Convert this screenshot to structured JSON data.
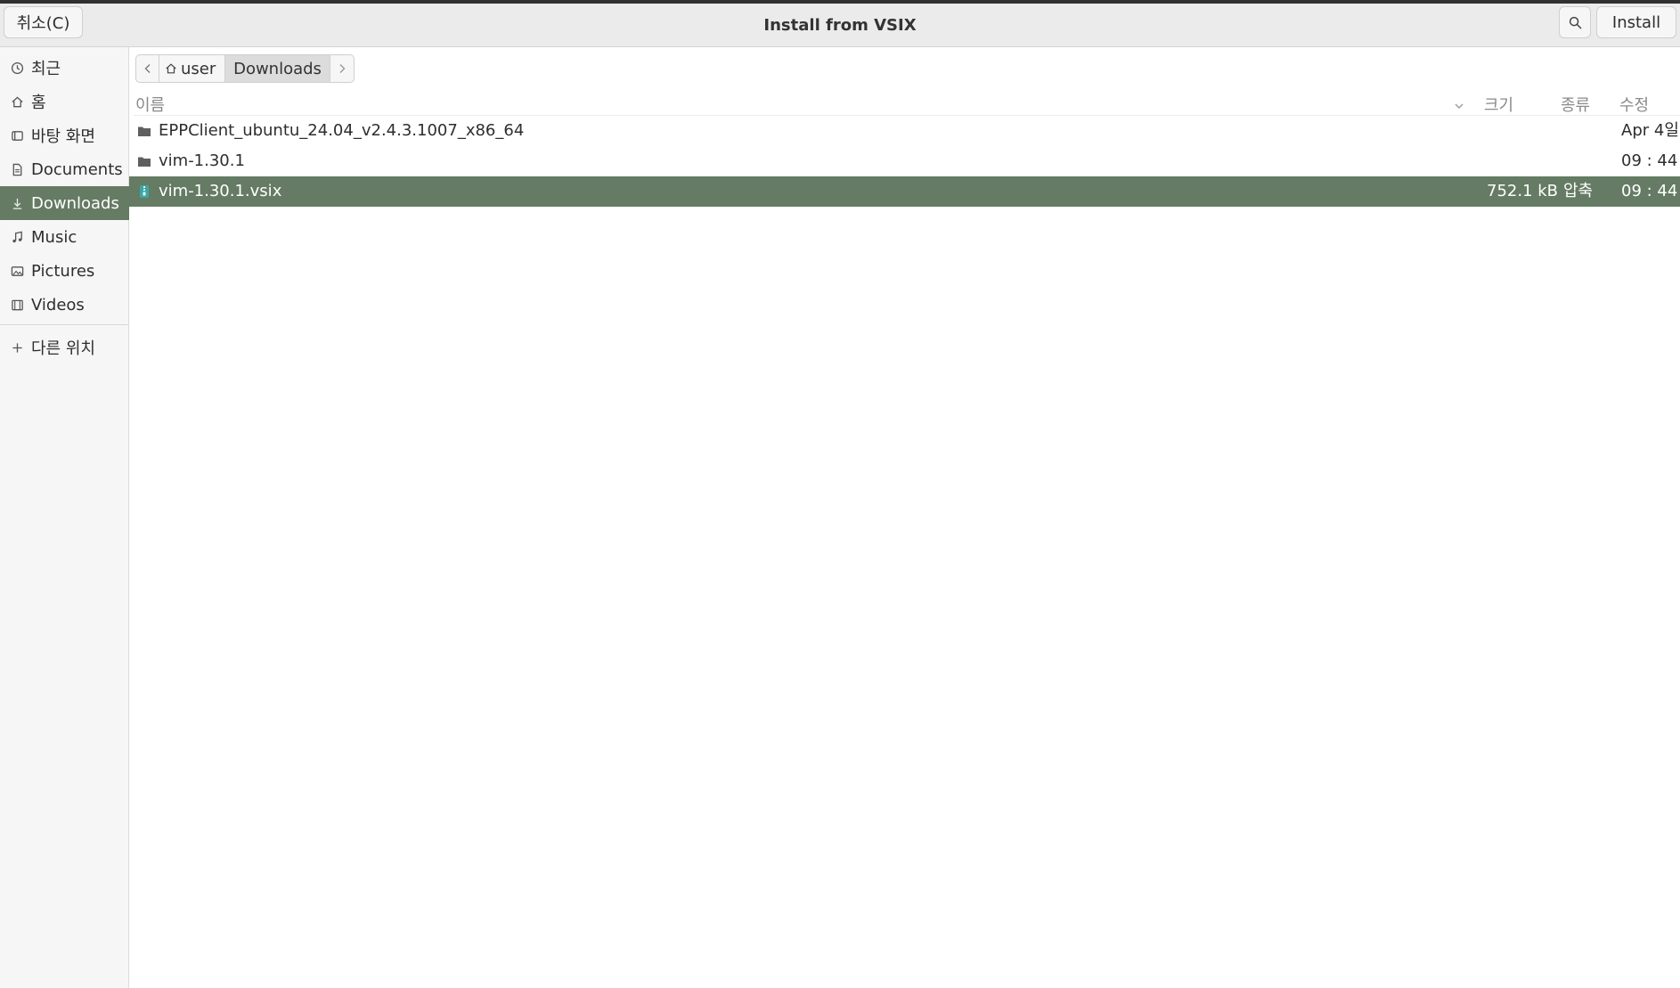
{
  "window": {
    "title": "Install from VSIX",
    "cancel_label": "취소(C)",
    "install_label": "Install",
    "search_icon": "search-icon"
  },
  "sidebar": {
    "items": [
      {
        "label": "최근",
        "icon": "clock-icon",
        "active": false
      },
      {
        "label": "홈",
        "icon": "home-icon",
        "active": false
      },
      {
        "label": "바탕 화면",
        "icon": "desktop-icon",
        "active": false
      },
      {
        "label": "Documents",
        "icon": "document-icon",
        "active": false
      },
      {
        "label": "Downloads",
        "icon": "download-icon",
        "active": true
      },
      {
        "label": "Music",
        "icon": "music-icon",
        "active": false
      },
      {
        "label": "Pictures",
        "icon": "picture-icon",
        "active": false
      },
      {
        "label": "Videos",
        "icon": "video-icon",
        "active": false
      }
    ],
    "other_locations": {
      "label": "다른 위치",
      "icon": "plus-icon"
    }
  },
  "pathbar": {
    "segments": [
      {
        "label": "user",
        "icon": "home-icon"
      },
      {
        "label": "Downloads",
        "current": true
      }
    ]
  },
  "file_list": {
    "columns": {
      "name": "이름",
      "size": "크기",
      "type": "종류",
      "modified": "수정"
    },
    "rows": [
      {
        "name": "EPPClient_ubuntu_24.04_v2.4.3.1007_x86_64",
        "icon": "folder-icon",
        "size": "",
        "type": "",
        "modified": "Apr 4일",
        "selected": false
      },
      {
        "name": "vim-1.30.1",
        "icon": "folder-icon",
        "size": "",
        "type": "",
        "modified": "09 : 44",
        "selected": false
      },
      {
        "name": "vim-1.30.1.vsix",
        "icon": "archive-file-icon",
        "size": "752.1 kB",
        "type": "압축",
        "modified": "09 : 44",
        "selected": true
      }
    ]
  },
  "colors": {
    "selection": "#657b64",
    "header_bg": "#ebebeb",
    "sidebar_bg": "#f6f6f6"
  }
}
